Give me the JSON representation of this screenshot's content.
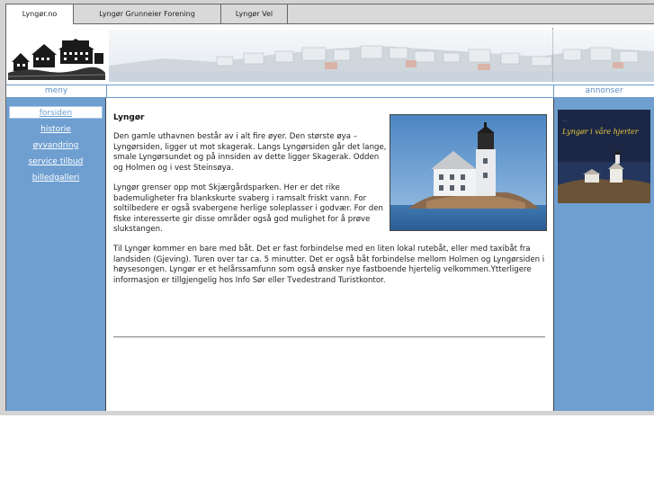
{
  "tabs": [
    {
      "label": "Lyngør.no",
      "active": true
    },
    {
      "label": "Lyngør Grunneier Forening",
      "active": false
    },
    {
      "label": "Lyngør Vel",
      "active": false
    }
  ],
  "sidebar": {
    "heading": "meny",
    "items": [
      {
        "label": "forsiden",
        "active": true
      },
      {
        "label": "historie"
      },
      {
        "label": "øyvandring"
      },
      {
        "label": "service tilbud"
      },
      {
        "label": "billedgalleri"
      }
    ]
  },
  "ads": {
    "heading": "annonser",
    "book_title": "Lyngør i våre hjerter"
  },
  "main": {
    "title": "Lyngør",
    "paragraphs": [
      "Den gamle uthavnen består av i alt fire øyer. Den største øya – Lyngørsiden, ligger ut mot skagerak. Langs Lyngørsiden går det lange, smale Lyngørsundet og på innsiden av dette ligger Skagerak. Odden og Holmen og i vest Steinsøya.",
      "Lyngør grenser opp mot Skjærgårdsparken. Her er det rike bademuligheter fra blankskurte svaberg i ramsalt friskt vann. For soltilbedere er også svabergene herlige soleplasser i godvær. For den fiske interesserte gir disse områder også god mulighet for å prøve slukstangen.",
      "Til Lyngør kommer en bare med båt. Det er fast forbindelse med en liten lokal rutebåt, eller med taxibåt fra landsiden (Gjeving). Turen over tar ca. 5 minutter. Det er også båt forbindelse mellom Holmen og Lyngørsiden i høysesongen. Lyngør er et helårssamfunn som også ønsker nye fastboende hjertelig velkommen.Ytterligere informasjon er tillgjengelig hos Info Sør eller Tvedestrand Turistkontor."
    ]
  },
  "colors": {
    "sidebar_blue": "#6f9fd1",
    "heading_blue": "#5b8fc6",
    "tab_gray": "#d9d9d9"
  }
}
